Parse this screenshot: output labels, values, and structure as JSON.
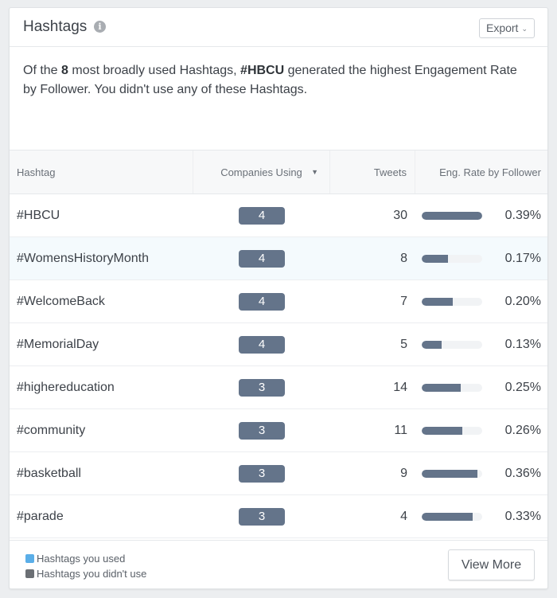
{
  "header": {
    "title": "Hashtags",
    "info_icon": "info-icon",
    "export_label": "Export",
    "export_icon": "chevron-down-icon"
  },
  "summary": {
    "prefix": "Of the ",
    "count": "8",
    "middle": " most broadly used Hashtags, ",
    "top_hashtag": "#HBCU",
    "suffix": " generated the highest Engagement Rate by Follower. You didn't use any of these Hashtags."
  },
  "table": {
    "columns": {
      "hashtag": "Hashtag",
      "companies": "Companies Using",
      "tweets": "Tweets",
      "rate": "Eng. Rate by Follower"
    },
    "sort_icon": "sort-caret-down-icon",
    "rows": [
      {
        "hashtag": "#HBCU",
        "companies": "4",
        "tweets": "30",
        "rate": "0.39%",
        "rate_value": 0.39
      },
      {
        "hashtag": "#WomensHistoryMonth",
        "companies": "4",
        "tweets": "8",
        "rate": "0.17%",
        "rate_value": 0.17
      },
      {
        "hashtag": "#WelcomeBack",
        "companies": "4",
        "tweets": "7",
        "rate": "0.20%",
        "rate_value": 0.2
      },
      {
        "hashtag": "#MemorialDay",
        "companies": "4",
        "tweets": "5",
        "rate": "0.13%",
        "rate_value": 0.13
      },
      {
        "hashtag": "#highereducation",
        "companies": "3",
        "tweets": "14",
        "rate": "0.25%",
        "rate_value": 0.25
      },
      {
        "hashtag": "#community",
        "companies": "3",
        "tweets": "11",
        "rate": "0.26%",
        "rate_value": 0.26
      },
      {
        "hashtag": "#basketball",
        "companies": "3",
        "tweets": "9",
        "rate": "0.36%",
        "rate_value": 0.36
      },
      {
        "hashtag": "#parade",
        "companies": "3",
        "tweets": "4",
        "rate": "0.33%",
        "rate_value": 0.33
      }
    ],
    "rate_max": 0.39,
    "highlighted_row": 1
  },
  "footer": {
    "legend": [
      {
        "label": "Hashtags you used",
        "color": "#5aaee8"
      },
      {
        "label": "Hashtags you didn't use",
        "color": "#6b6f74"
      }
    ],
    "view_more_label": "View More"
  },
  "colors": {
    "bar": "#64748a",
    "badge": "#64748a"
  }
}
